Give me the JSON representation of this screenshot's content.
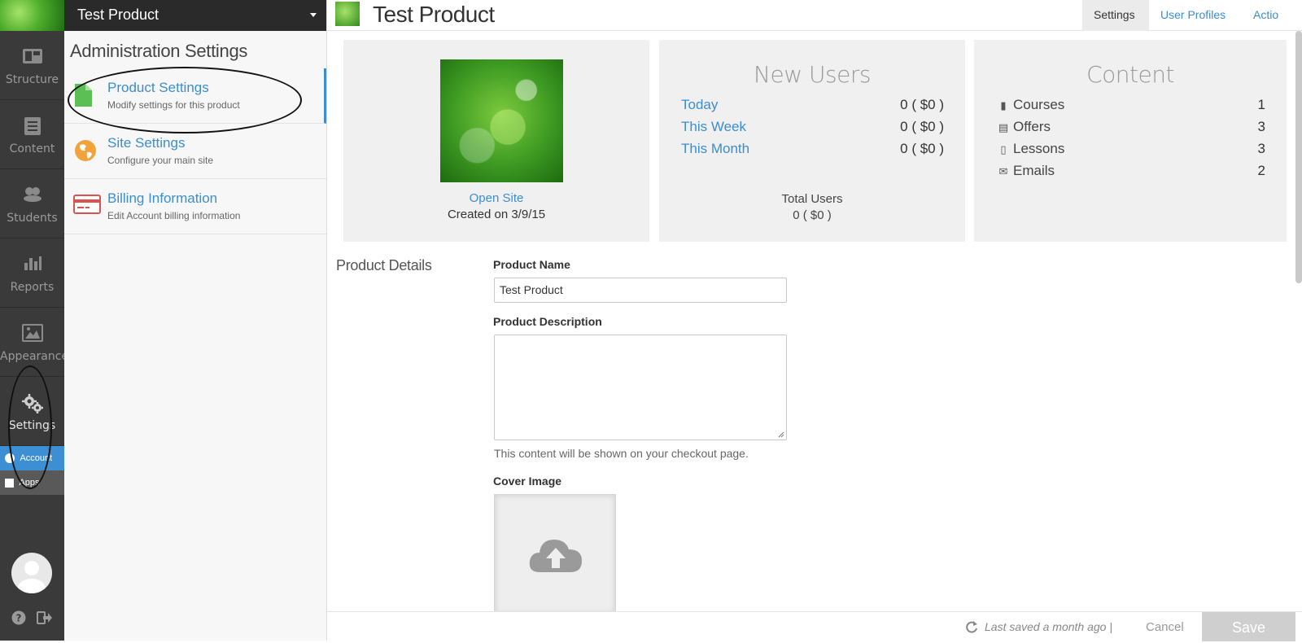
{
  "rail": {
    "items": [
      {
        "label": "Structure"
      },
      {
        "label": "Content"
      },
      {
        "label": "Students"
      },
      {
        "label": "Reports"
      },
      {
        "label": "Appearance"
      },
      {
        "label": "Settings"
      }
    ],
    "sub_account": "Account",
    "sub_apps": "Apps"
  },
  "admin": {
    "product_selector": "Test Product",
    "title": "Administration Settings",
    "items": [
      {
        "title": "Product Settings",
        "subtitle": "Modify settings for this product"
      },
      {
        "title": "Site Settings",
        "subtitle": "Configure your main site"
      },
      {
        "title": "Billing Information",
        "subtitle": "Edit Account billing information"
      }
    ]
  },
  "header": {
    "title": "Test Product",
    "tabs": [
      {
        "label": "Settings"
      },
      {
        "label": "User Profiles"
      },
      {
        "label": "Actio"
      }
    ]
  },
  "overview": {
    "open_site": "Open Site",
    "created": "Created on 3/9/15"
  },
  "new_users": {
    "title": "New Users",
    "rows": [
      {
        "label": "Today",
        "value": "0 ( $0 )"
      },
      {
        "label": "This Week",
        "value": "0 ( $0 )"
      },
      {
        "label": "This Month",
        "value": "0 ( $0 )"
      }
    ],
    "total_label": "Total Users",
    "total_value": "0 ( $0 )"
  },
  "content": {
    "title": "Content",
    "rows": [
      {
        "label": "Courses",
        "value": "1",
        "icon": "book-icon"
      },
      {
        "label": "Offers",
        "value": "3",
        "icon": "credit-card-icon"
      },
      {
        "label": "Lessons",
        "value": "3",
        "icon": "file-icon"
      },
      {
        "label": "Emails",
        "value": "2",
        "icon": "envelope-icon"
      }
    ]
  },
  "form": {
    "section": "Product Details",
    "name_label": "Product Name",
    "name_value": "Test Product",
    "desc_label": "Product Description",
    "desc_value": "",
    "desc_help": "This content will be shown on your checkout page.",
    "cover_label": "Cover Image"
  },
  "footer": {
    "saved": "Last saved a month ago |",
    "cancel": "Cancel",
    "save": "Save"
  },
  "colors": {
    "accent": "#3c8dce",
    "rail": "#3a3a3a",
    "panel": "#f0f0f0"
  }
}
